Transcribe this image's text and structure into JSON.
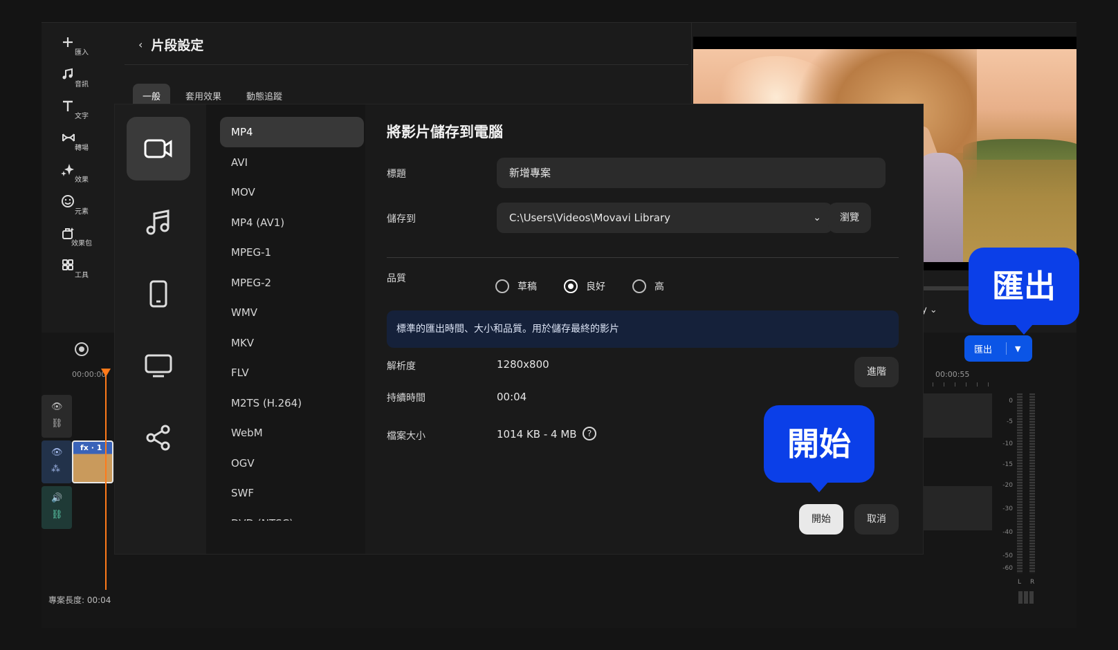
{
  "toolbar": {
    "items": [
      {
        "label": "匯入",
        "icon": "plus-icon"
      },
      {
        "label": "音訊",
        "icon": "music-note-icon"
      },
      {
        "label": "文字",
        "icon": "text-T-icon"
      },
      {
        "label": "轉場",
        "icon": "transition-bowtie-icon"
      },
      {
        "label": "效果",
        "icon": "sparkle-effects-icon"
      },
      {
        "label": "元素",
        "icon": "smiley-icon"
      },
      {
        "label": "效果包",
        "icon": "effect-pack-icon"
      },
      {
        "label": "工具",
        "icon": "tools-grid-icon"
      }
    ]
  },
  "clip_settings": {
    "title": "片段設定",
    "tabs": [
      "一般",
      "套用效果",
      "動態追蹤"
    ],
    "active_tab": "一般"
  },
  "preview": {
    "aspect_label": "x:y"
  },
  "export_button": {
    "label": "匯出"
  },
  "timeline": {
    "start_time": "00:00:00",
    "end_time": "00:00:55",
    "clip_label": "fx · 1",
    "project_length": "專案長度: 00:04",
    "meter_scale": [
      "0",
      "-5",
      "-10",
      "-15",
      "-20",
      "-30",
      "-40",
      "-50",
      "-60"
    ],
    "meter_left": "L",
    "meter_right": "R"
  },
  "dialog": {
    "categories": [
      "video-camera-icon",
      "music-icon",
      "mobile-phone-icon",
      "tv-monitor-icon",
      "share-icon"
    ],
    "active_category": 0,
    "formats": [
      "MP4",
      "AVI",
      "MOV",
      "MP4 (AV1)",
      "MPEG-1",
      "MPEG-2",
      "WMV",
      "MKV",
      "FLV",
      "M2TS (H.264)",
      "WebM",
      "OGV",
      "SWF",
      "DVD (NTSC)"
    ],
    "active_format": "MP4",
    "heading": "將影片儲存到電腦",
    "title_label": "標題",
    "title_value": "新增專案",
    "save_to_label": "儲存到",
    "save_to_value": "C:\\Users\\Videos\\Movavi Library",
    "browse_label": "瀏覽",
    "quality_label": "品質",
    "quality_options": [
      "草稿",
      "良好",
      "高"
    ],
    "quality_selected": "良好",
    "quality_info": "標準的匯出時間、大小和品質。用於儲存最終的影片",
    "resolution_label": "解析度",
    "resolution_value": "1280x800",
    "advanced_label": "進階",
    "duration_label": "持續時間",
    "duration_value": "00:04",
    "filesize_label": "檔案大小",
    "filesize_value": "1014 KB - 4 MB",
    "start_label": "開始",
    "cancel_label": "取消"
  },
  "callouts": {
    "export": "匯出",
    "start": "開始"
  },
  "colors": {
    "accent": "#0b55e6",
    "callout": "#0b3fe8",
    "playhead": "#ff7a1a"
  }
}
